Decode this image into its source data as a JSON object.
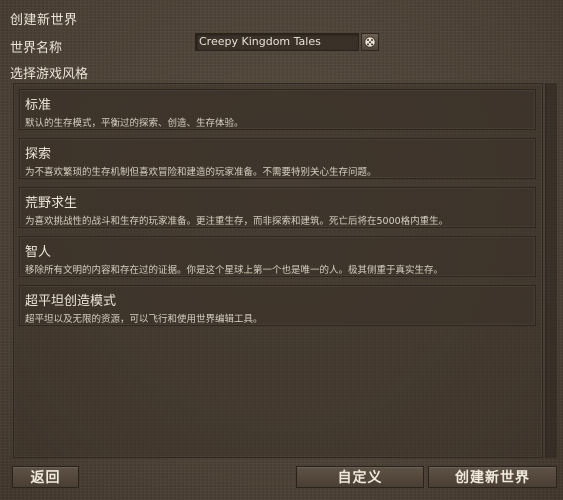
{
  "header": {
    "title": "创建新世界"
  },
  "world_name": {
    "label": "世界名称",
    "value": "Creepy Kingdom Tales",
    "random_icon": "dice-icon"
  },
  "style_section": {
    "label": "选择游戏风格",
    "options": [
      {
        "title": "标准",
        "description": "默认的生存模式，平衡过的探索、创造、生存体验。"
      },
      {
        "title": "探索",
        "description": "为不喜欢繁琐的生存机制但喜欢冒险和建造的玩家准备。不需要特别关心生存问题。"
      },
      {
        "title": "荒野求生",
        "description": "为喜欢挑战性的战斗和生存的玩家准备。更注重生存，而非探索和建筑。死亡后将在5000格内重生。"
      },
      {
        "title": "智人",
        "description": "移除所有文明的内容和存在过的证据。你是这个星球上第一个也是唯一的人。极其侧重于真实生存。"
      },
      {
        "title": "超平坦创造模式",
        "description": "超平坦以及无限的资源，可以飞行和使用世界编辑工具。"
      }
    ]
  },
  "footer": {
    "back_label": "返回",
    "custom_label": "自定义",
    "create_label": "创建新世界"
  },
  "colors": {
    "background": "#4d4236",
    "panel": "#3c332a",
    "text": "#ece5d8"
  }
}
